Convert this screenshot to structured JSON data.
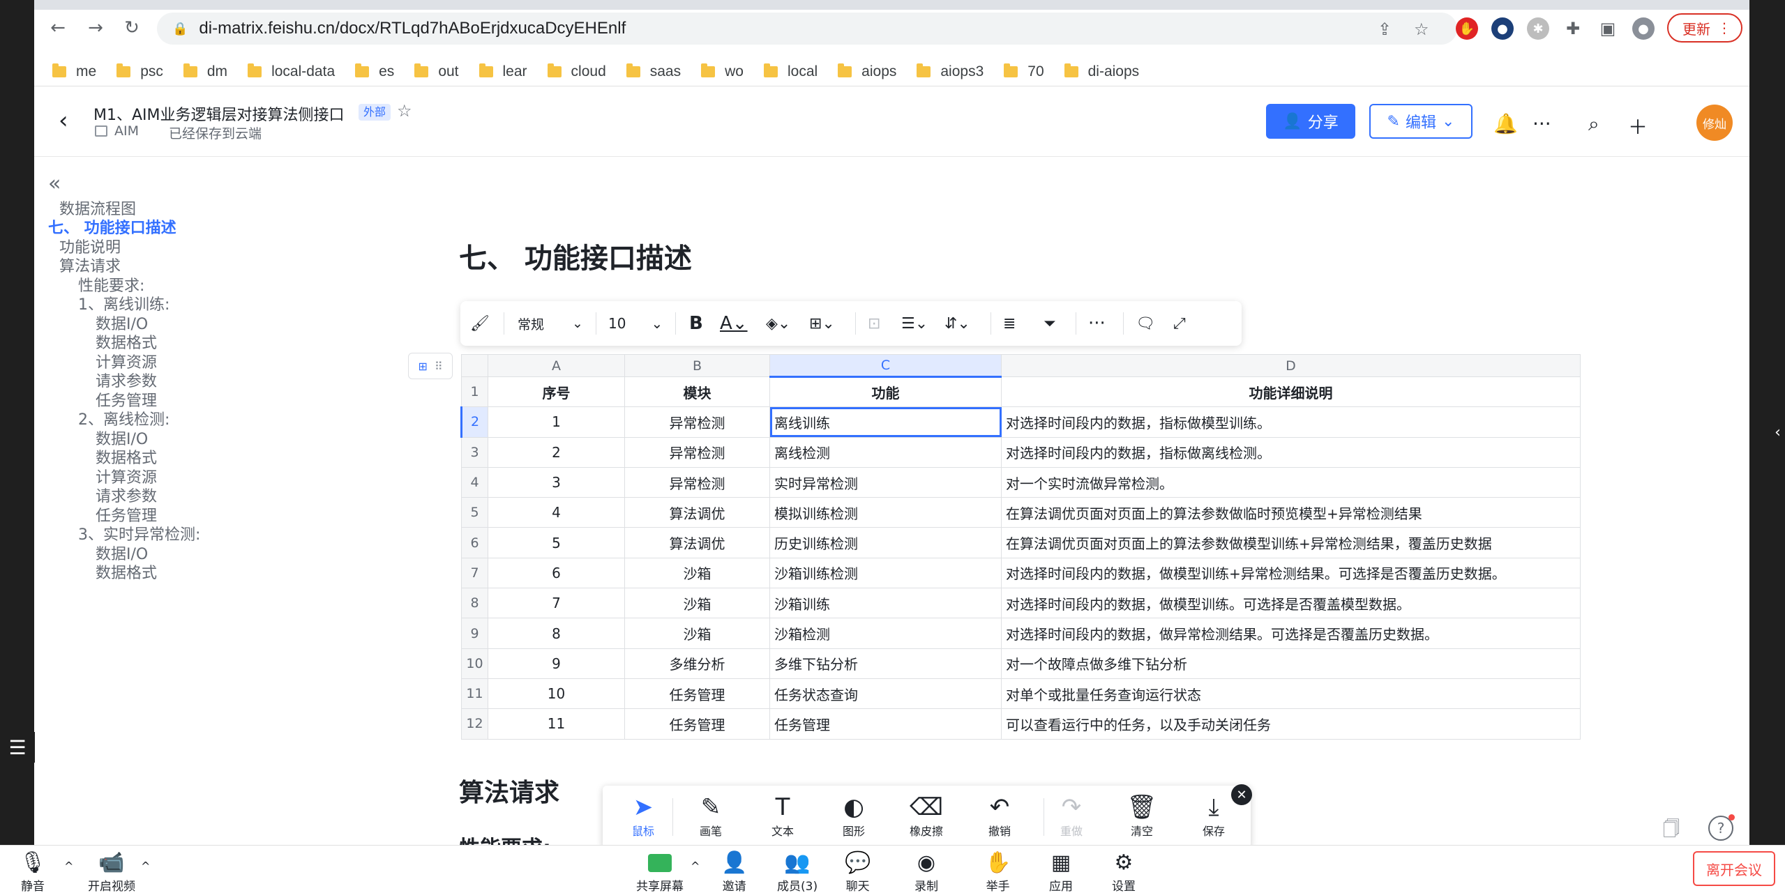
{
  "browser": {
    "url": "di-matrix.feishu.cn/docx/RTLqd7hABoErjdxucaDcyEHEnlf",
    "update_label": "更新",
    "bookmarks": [
      "me",
      "psc",
      "dm",
      "local-data",
      "es",
      "out",
      "lear",
      "cloud",
      "saas",
      "wo",
      "local",
      "aiops",
      "aiops3",
      "70",
      "di-aiops"
    ]
  },
  "header": {
    "title": "M1、AIM业务逻辑层对接算法侧接口",
    "external_tag": "外部",
    "space": "AIM",
    "saved_status": "已经保存到云端",
    "share_label": "分享",
    "edit_label": "编辑",
    "avatar_text": "修灿"
  },
  "toc": {
    "items": [
      {
        "label": "数据流程图",
        "level": 1
      },
      {
        "label": "七、 功能接口描述",
        "level": 0,
        "active": true
      },
      {
        "label": "功能说明",
        "level": 1
      },
      {
        "label": "算法请求",
        "level": 1
      },
      {
        "label": "性能要求:",
        "level": 2
      },
      {
        "label": "1、离线训练:",
        "level": 2
      },
      {
        "label": "数据I/O",
        "level": 3
      },
      {
        "label": "数据格式",
        "level": 3
      },
      {
        "label": "计算资源",
        "level": 3
      },
      {
        "label": "请求参数",
        "level": 3
      },
      {
        "label": "任务管理",
        "level": 3
      },
      {
        "label": "2、离线检测:",
        "level": 2
      },
      {
        "label": "数据I/O",
        "level": 3
      },
      {
        "label": "数据格式",
        "level": 3
      },
      {
        "label": "计算资源",
        "level": 3
      },
      {
        "label": "请求参数",
        "level": 3
      },
      {
        "label": "任务管理",
        "level": 3
      },
      {
        "label": "3、实时异常检测:",
        "level": 2
      },
      {
        "label": "数据I/O",
        "level": 3
      },
      {
        "label": "数据格式",
        "level": 3
      }
    ]
  },
  "main": {
    "section_heading": "七、 功能接口描述",
    "next_heading": "算法请求",
    "next_subheading": "性能要求:"
  },
  "sheet_toolbar": {
    "style_label": "常规",
    "font_size": "10"
  },
  "sheet": {
    "columns": [
      "A",
      "B",
      "C",
      "D"
    ],
    "header_row": [
      "序号",
      "模块",
      "功能",
      "功能详细说明"
    ],
    "rows": [
      [
        "1",
        "异常检测",
        "离线训练",
        "对选择时间段内的数据，指标做模型训练。"
      ],
      [
        "2",
        "异常检测",
        "离线检测",
        "对选择时间段内的数据，指标做离线检测。"
      ],
      [
        "3",
        "异常检测",
        "实时异常检测",
        "对一个实时流做异常检测。"
      ],
      [
        "4",
        "算法调优",
        "模拟训练检测",
        "在算法调优页面对页面上的算法参数做临时预览模型+异常检测结果"
      ],
      [
        "5",
        "算法调优",
        "历史训练检测",
        "在算法调优页面对页面上的算法参数做模型训练+异常检测结果，覆盖历史数据"
      ],
      [
        "6",
        "沙箱",
        "沙箱训练检测",
        "对选择时间段内的数据，做模型训练+异常检测结果。可选择是否覆盖历史数据。"
      ],
      [
        "7",
        "沙箱",
        "沙箱训练",
        "对选择时间段内的数据，做模型训练。可选择是否覆盖模型数据。"
      ],
      [
        "8",
        "沙箱",
        "沙箱检测",
        "对选择时间段内的数据，做异常检测结果。可选择是否覆盖历史数据。"
      ],
      [
        "9",
        "多维分析",
        "多维下钻分析",
        "对一个故障点做多维下钻分析"
      ],
      [
        "10",
        "任务管理",
        "任务状态查询",
        "对单个或批量任务查询运行状态"
      ],
      [
        "11",
        "任务管理",
        "任务管理",
        "可以查看运行中的任务，以及手动关闭任务"
      ]
    ]
  },
  "annotation_bar": {
    "tools": [
      {
        "label": "鼠标",
        "icon": "cursor-icon"
      },
      {
        "label": "画笔",
        "icon": "pen-icon"
      },
      {
        "label": "文本",
        "icon": "text-icon"
      },
      {
        "label": "图形",
        "icon": "shape-icon"
      },
      {
        "label": "橡皮擦",
        "icon": "eraser-icon"
      },
      {
        "label": "撤销",
        "icon": "undo-icon"
      },
      {
        "label": "重做",
        "icon": "redo-icon"
      },
      {
        "label": "清空",
        "icon": "trash-icon"
      },
      {
        "label": "保存",
        "icon": "download-icon"
      }
    ]
  },
  "meeting_bar": {
    "mute": "静音",
    "video": "开启视频",
    "share": "共享屏幕",
    "invite": "邀请",
    "members": "成员(3)",
    "chat": "聊天",
    "record": "录制",
    "raise_hand": "举手",
    "apps": "应用",
    "settings": "设置",
    "leave": "离开会议"
  },
  "colors": {
    "accent": "#3370ff",
    "danger": "#f54a45",
    "avatar": "#f08a24"
  }
}
